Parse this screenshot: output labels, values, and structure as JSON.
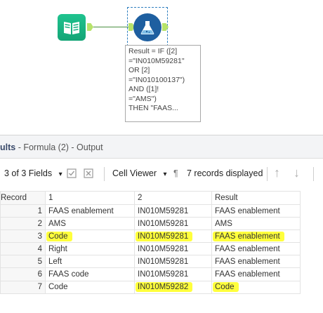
{
  "workflow": {
    "input_tool_icon": "book-input-icon",
    "formula_tool_icon": "flask-formula-icon",
    "annotation": "Result = IF ([2]\n=\"IN010M59281\"\nOR [2]\n=\"IN010100137\")\nAND ([1]!\n=\"AMS\")\nTHEN \"FAAS..."
  },
  "results": {
    "title_prefix": "ults",
    "title_rest": " - Formula (2) - Output"
  },
  "toolbar": {
    "fields_label": "3 of 3 Fields",
    "fields_dropdown_icon": "▾",
    "cell_viewer_label": "Cell Viewer",
    "cell_viewer_dropdown_icon": "▾",
    "pilcrow_icon": "¶",
    "records_label": "7 records displayed",
    "up_icon": "↑",
    "down_icon": "↓"
  },
  "grid": {
    "headers": [
      "Record",
      "1",
      "2",
      "Result"
    ],
    "rows": [
      {
        "record": "1",
        "c1": "FAAS enablement",
        "c2": "IN010M59281",
        "result": "FAAS enablement",
        "highlight": [
          false,
          false,
          false
        ]
      },
      {
        "record": "2",
        "c1": "AMS",
        "c2": "IN010M59281",
        "result": "AMS",
        "highlight": [
          false,
          false,
          false
        ]
      },
      {
        "record": "3",
        "c1": "Code",
        "c2": "IN010M59281",
        "result": "FAAS enablement",
        "highlight": [
          true,
          true,
          true
        ]
      },
      {
        "record": "4",
        "c1": "Right",
        "c2": "IN010M59281",
        "result": "FAAS enablement",
        "highlight": [
          false,
          false,
          false
        ]
      },
      {
        "record": "5",
        "c1": "Left",
        "c2": "IN010M59281",
        "result": "FAAS enablement",
        "highlight": [
          false,
          false,
          false
        ]
      },
      {
        "record": "6",
        "c1": "FAAS code",
        "c2": "IN010M59281",
        "result": "FAAS enablement",
        "highlight": [
          false,
          false,
          false
        ]
      },
      {
        "record": "7",
        "c1": "Code",
        "c2": "IN010M59282",
        "result": "Code",
        "highlight": [
          false,
          true,
          true
        ]
      }
    ],
    "highlight_color": "#ffff3c"
  }
}
